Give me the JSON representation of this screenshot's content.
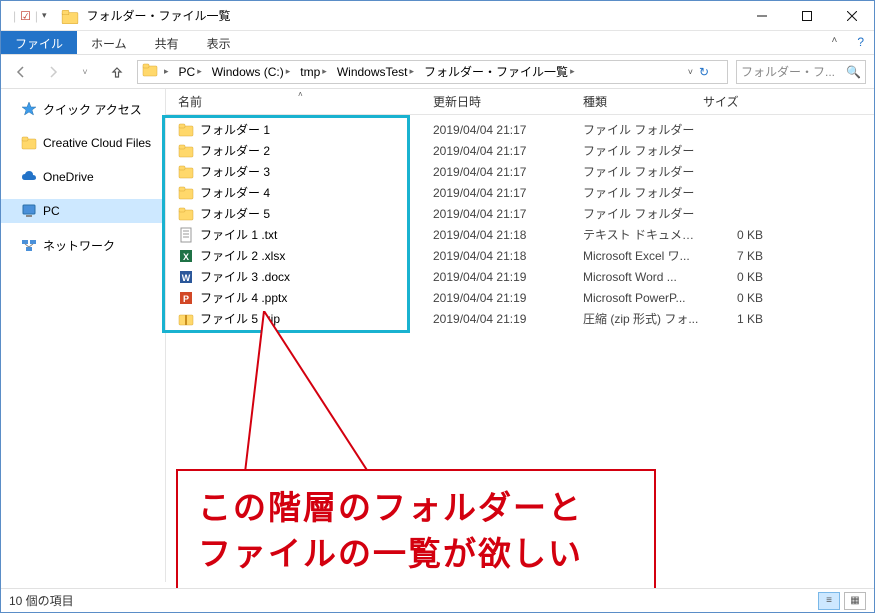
{
  "title": "フォルダー・ファイル一覧",
  "ribbon": {
    "file": "ファイル",
    "home": "ホーム",
    "share": "共有",
    "view": "表示"
  },
  "breadcrumbs": [
    "PC",
    "Windows (C:)",
    "tmp",
    "WindowsTest",
    "フォルダー・ファイル一覧"
  ],
  "search_placeholder": "フォルダー・フ...",
  "sidebar": {
    "items": [
      {
        "label": "クイック アクセス",
        "icon": "star"
      },
      {
        "label": "Creative Cloud Files",
        "icon": "folder"
      },
      {
        "label": "OneDrive",
        "icon": "cloud"
      },
      {
        "label": "PC",
        "icon": "pc",
        "selected": true
      },
      {
        "label": "ネットワーク",
        "icon": "network"
      }
    ]
  },
  "columns": {
    "name": "名前",
    "date": "更新日時",
    "type": "種類",
    "size": "サイズ"
  },
  "files": [
    {
      "name": "フォルダー 1",
      "date": "2019/04/04 21:17",
      "type": "ファイル フォルダー",
      "size": "",
      "icon": "folder"
    },
    {
      "name": "フォルダー 2",
      "date": "2019/04/04 21:17",
      "type": "ファイル フォルダー",
      "size": "",
      "icon": "folder"
    },
    {
      "name": "フォルダー 3",
      "date": "2019/04/04 21:17",
      "type": "ファイル フォルダー",
      "size": "",
      "icon": "folder"
    },
    {
      "name": "フォルダー 4",
      "date": "2019/04/04 21:17",
      "type": "ファイル フォルダー",
      "size": "",
      "icon": "folder"
    },
    {
      "name": "フォルダー 5",
      "date": "2019/04/04 21:17",
      "type": "ファイル フォルダー",
      "size": "",
      "icon": "folder"
    },
    {
      "name": "ファイル 1 .txt",
      "date": "2019/04/04 21:18",
      "type": "テキスト ドキュメント",
      "size": "0 KB",
      "icon": "txt"
    },
    {
      "name": "ファイル 2 .xlsx",
      "date": "2019/04/04 21:18",
      "type": "Microsoft Excel ワ...",
      "size": "7 KB",
      "icon": "xlsx"
    },
    {
      "name": "ファイル 3 .docx",
      "date": "2019/04/04 21:19",
      "type": "Microsoft Word ...",
      "size": "0 KB",
      "icon": "docx"
    },
    {
      "name": "ファイル 4 .pptx",
      "date": "2019/04/04 21:19",
      "type": "Microsoft PowerP...",
      "size": "0 KB",
      "icon": "pptx"
    },
    {
      "name": "ファイル 5 .zip",
      "date": "2019/04/04 21:19",
      "type": "圧縮 (zip 形式) フォ...",
      "size": "1 KB",
      "icon": "zip"
    }
  ],
  "status": "10 個の項目",
  "callout": {
    "line1": "この階層のフォルダーと",
    "line2": "ファイルの一覧が欲しい"
  }
}
